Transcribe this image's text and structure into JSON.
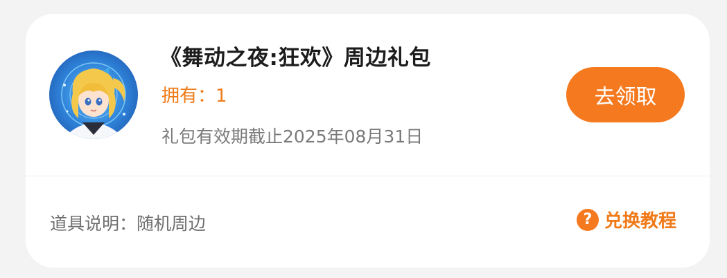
{
  "gift": {
    "title": "《舞动之夜:狂欢》周边礼包",
    "owned_label": "拥有：1",
    "validity": "礼包有效期截止2025年08月31日",
    "claim_label": "去领取",
    "avatar_icon": "anime-character-avatar"
  },
  "footer": {
    "description": "道具说明：随机周边",
    "tutorial_label": "兑换教程",
    "tutorial_icon": "question-circle-icon",
    "help_glyph": "?"
  },
  "colors": {
    "accent": "#f57a1f",
    "title": "#1c1c1c",
    "muted": "#7a7a7a",
    "background": "#f3f3f3",
    "card": "#ffffff"
  }
}
